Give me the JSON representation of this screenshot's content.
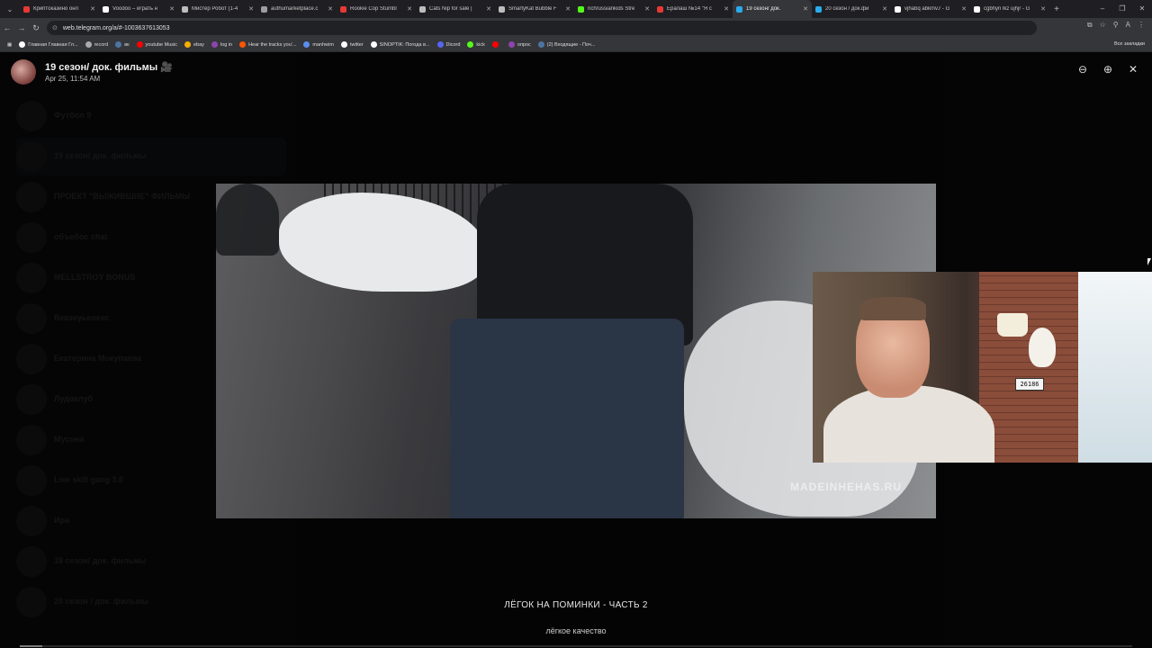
{
  "browser": {
    "tabs": [
      {
        "title": "Криптоказино онл",
        "color": "#e53935"
      },
      {
        "title": "Voodoo – играть н",
        "color": "#ffffff"
      },
      {
        "title": "Мистер Робот (1-4",
        "color": "#bdbdbd"
      },
      {
        "title": "authumarketplace.c",
        "color": "#9e9e9e"
      },
      {
        "title": "Rookie Cop Stumbl",
        "color": "#e53935"
      },
      {
        "title": "Cats Nip for sale |",
        "color": "#bdbdbd"
      },
      {
        "title": "SmartyKat Bubble F",
        "color": "#bdbdbd"
      },
      {
        "title": "richrussiankids Stre",
        "color": "#53fc18"
      },
      {
        "title": "Ералаш №14 \"Я с",
        "color": "#e53935"
      },
      {
        "title": "19 сезон/ док.",
        "color": "#2aabee",
        "active": true
      },
      {
        "title": "20 сезон / док.фи",
        "color": "#2aabee"
      },
      {
        "title": "vjhabq abkmv.r - G",
        "color": "#ffffff"
      },
      {
        "title": "cgbhyn lkz ujhjr - G",
        "color": "#ffffff"
      }
    ],
    "url": "web.telegram.org/a/#-1003637613053",
    "bookmarks": [
      {
        "label": "Главная Главная Гл...",
        "color": "#ffffff"
      },
      {
        "label": "record",
        "color": "#aaaaaa"
      },
      {
        "label": "вк",
        "color": "#4c75a3"
      },
      {
        "label": "youtube Music",
        "color": "#ff0000"
      },
      {
        "label": "ebay",
        "color": "#f5af02"
      },
      {
        "label": "log in",
        "color": "#8e44ad"
      },
      {
        "label": "Hear the tracks you'...",
        "color": "#ff5500"
      },
      {
        "label": "manhwim",
        "color": "#5b8def"
      },
      {
        "label": "twitter",
        "color": "#ffffff"
      },
      {
        "label": "SINOPTIK: Погода в...",
        "color": "#ffffff"
      },
      {
        "label": "Dicord",
        "color": "#5865f2"
      },
      {
        "label": "kick",
        "color": "#53fc18"
      },
      {
        "label": "",
        "color": "#ff0000"
      },
      {
        "label": "опрос",
        "color": "#8e44ad"
      },
      {
        "label": "(2) Входящие - Поч...",
        "color": "#4c75a3"
      }
    ],
    "all_bookmarks": "Все закладки"
  },
  "viewer": {
    "channel": "19 сезон/ док. фильмы 🎥",
    "datetime": "Apr 25, 11:54 AM",
    "watermark": "MADEINHEHAS.RU",
    "caption_title": "ЛЁГОК НА ПОМИНКИ - ЧАСТЬ 2",
    "caption_sub": "лёгкое качество",
    "progress": 0.02,
    "pip_plate": "26186"
  },
  "sidebar": {
    "chats": [
      {
        "name": "Футбол 9",
        "preview": ""
      },
      {
        "name": "19 сезон/ док. фильмы",
        "preview": "",
        "selected": true
      },
      {
        "name": "ПРОЕКТ \"ВЫЖИВШИЕ\" ФИЛЬМЫ",
        "preview": ""
      },
      {
        "name": "объебос chat",
        "preview": ""
      },
      {
        "name": "MELLSTROY BONUS",
        "preview": ""
      },
      {
        "name": "Вкаэеуьеоекс",
        "preview": ""
      },
      {
        "name": "Екатерина Мокупаева",
        "preview": ""
      },
      {
        "name": "Лудоклуб",
        "preview": ""
      },
      {
        "name": "Мусона",
        "preview": ""
      },
      {
        "name": "Low skill gang 3.0",
        "preview": ""
      },
      {
        "name": "Ира",
        "preview": ""
      },
      {
        "name": "18 сезон/ док. фильмы",
        "preview": ""
      },
      {
        "name": "20 сезон / док. фильмы",
        "preview": ""
      }
    ]
  }
}
